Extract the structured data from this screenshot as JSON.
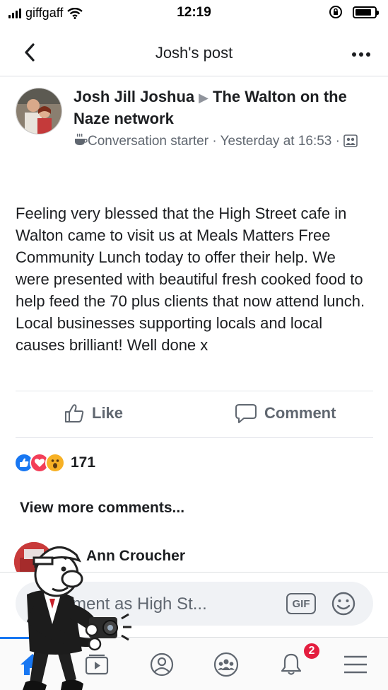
{
  "status_bar": {
    "carrier": "giffgaff",
    "time": "12:19"
  },
  "nav": {
    "title": "Josh's post",
    "back_icon": "chevron-left-icon",
    "more_icon": "more-dots-icon"
  },
  "post": {
    "author": "Josh Jill Joshua",
    "target": "The Walton on the Naze network",
    "badge": "Conversation starter",
    "separator": "·",
    "timestamp": "Yesterday at 16:53",
    "separator2": "·",
    "text": "Feeling very blessed that the High Street cafe in Walton came to visit us at Meals Matters Free Community Lunch today to offer their help. We were presented with beautiful fresh cooked food to help feed the 70 plus clients that now attend lunch. Local businesses supporting locals and local causes brilliant! Well done x"
  },
  "actions": {
    "like_label": "Like",
    "comment_label": "Comment"
  },
  "reactions": {
    "count": "171",
    "types": [
      "like",
      "love",
      "wow"
    ]
  },
  "comments": {
    "view_more": "View more comments...",
    "items": [
      {
        "author": "Ann Croucher"
      }
    ]
  },
  "composer": {
    "placeholder": "mment as High St...",
    "gif_label": "GIF"
  },
  "tabbar": {
    "notification_count": "2",
    "tabs": [
      "home",
      "watch",
      "profile",
      "groups",
      "notifications",
      "menu"
    ]
  },
  "colors": {
    "accent": "#1877f2",
    "love": "#f33e58",
    "wow": "#f7b125",
    "badge": "#e41e3f"
  }
}
